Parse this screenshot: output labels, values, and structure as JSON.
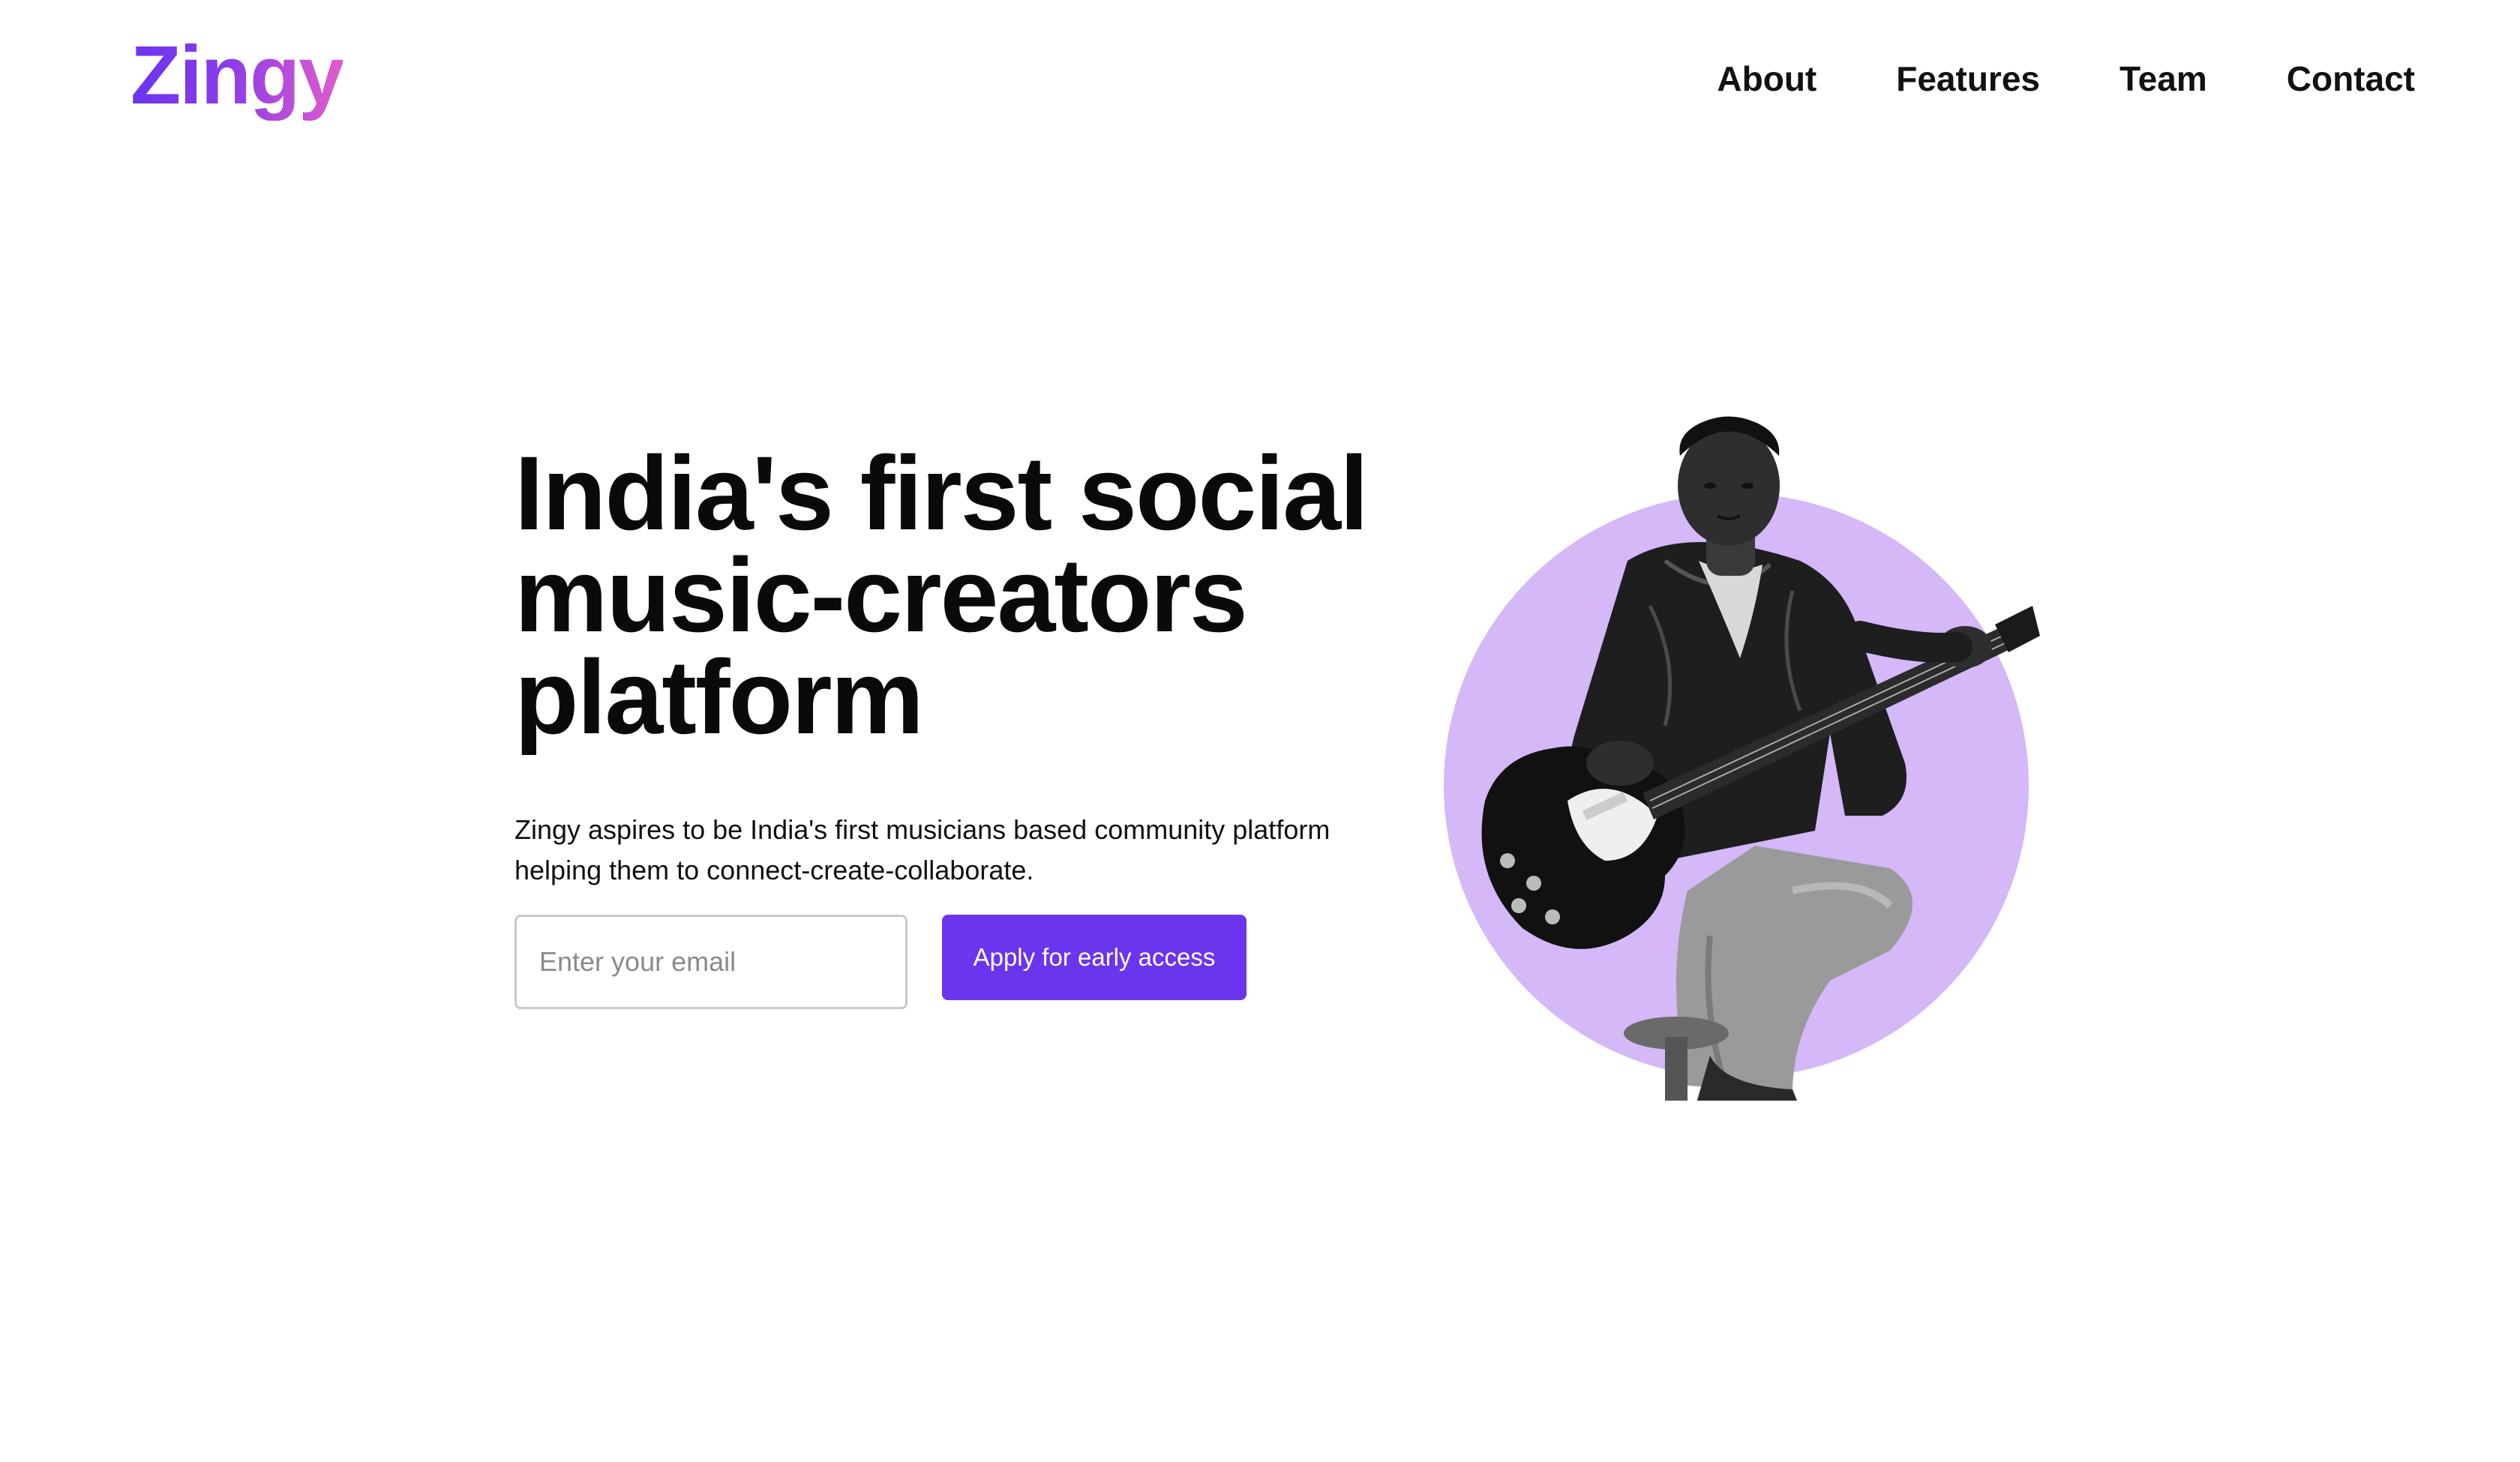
{
  "brand": {
    "logo_text": "Zingy",
    "gradient_start": "#6b35f0",
    "gradient_end": "#e25ccc"
  },
  "nav": {
    "items": [
      {
        "label": "About"
      },
      {
        "label": "Features"
      },
      {
        "label": "Team"
      },
      {
        "label": "Contact"
      }
    ]
  },
  "hero": {
    "headline_line1": "India's first social",
    "headline_line2": "music-creators",
    "headline_line3": "platform",
    "subtext_line1": "Zingy aspires to be India's first musicians based community platform",
    "subtext_line2": "helping them to connect-create-collaborate.",
    "email_placeholder": "Enter your email",
    "email_value": "",
    "cta_label": "Apply for early access",
    "accent_color": "#6a35ec",
    "circle_color": "#d4b8f8"
  }
}
